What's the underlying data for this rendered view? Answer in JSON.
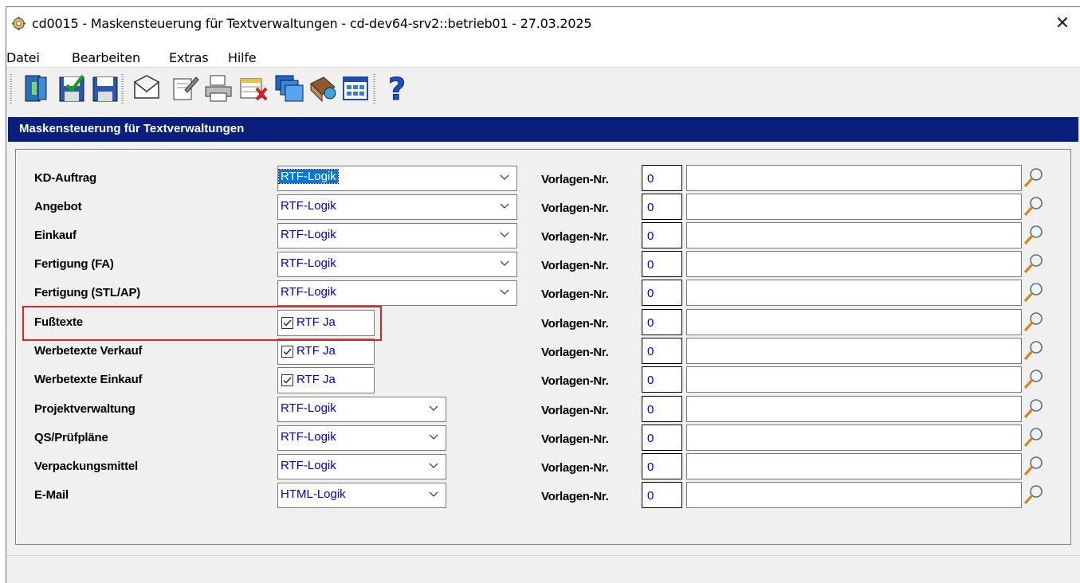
{
  "window": {
    "title": "cd0015 - Maskensteuerung für Textverwaltungen - cd-dev64-srv2::betrieb01 - 27.03.2025",
    "close_symbol": "✕"
  },
  "menu": [
    {
      "label": "Datei",
      "name": "menu-datei"
    },
    {
      "label": "Bearbeiten",
      "name": "menu-bearbeiten"
    },
    {
      "label": "Extras",
      "name": "menu-extras"
    },
    {
      "label": "Hilfe",
      "name": "menu-hilfe"
    }
  ],
  "toolbar": [
    {
      "icon": "exit-door-icon"
    },
    {
      "icon": "save-check-icon"
    },
    {
      "icon": "save-icon"
    },
    {
      "icon": "envelope-icon"
    },
    {
      "icon": "edit-document-icon"
    },
    {
      "icon": "printer-icon"
    },
    {
      "icon": "delete-record-icon"
    },
    {
      "icon": "windows-icon"
    },
    {
      "icon": "book-icon"
    },
    {
      "icon": "table-icon"
    },
    {
      "icon": "help-icon"
    }
  ],
  "panel": {
    "title": "Maskensteuerung für Textverwaltungen"
  },
  "rows": [
    {
      "label": "KD-Auftrag",
      "type": "combo",
      "value": "RTF-Logik",
      "selected": true,
      "wide": true,
      "vor_label": "Vorlagen-Nr.",
      "vor_value": "0",
      "vor_text": ""
    },
    {
      "label": "Angebot",
      "type": "combo",
      "value": "RTF-Logik",
      "selected": false,
      "wide": true,
      "vor_label": "Vorlagen-Nr.",
      "vor_value": "0",
      "vor_text": ""
    },
    {
      "label": "Einkauf",
      "type": "combo",
      "value": "RTF-Logik",
      "selected": false,
      "wide": true,
      "vor_label": "Vorlagen-Nr.",
      "vor_value": "0",
      "vor_text": ""
    },
    {
      "label": "Fertigung (FA)",
      "type": "combo",
      "value": "RTF-Logik",
      "selected": false,
      "wide": true,
      "vor_label": "Vorlagen-Nr.",
      "vor_value": "0",
      "vor_text": ""
    },
    {
      "label": "Fertigung (STL/AP)",
      "type": "combo",
      "value": "RTF-Logik",
      "selected": false,
      "wide": true,
      "vor_label": "Vorlagen-Nr.",
      "vor_value": "0",
      "vor_text": ""
    },
    {
      "label": "Fußtexte",
      "type": "check",
      "value": "RTF Ja",
      "checked": true,
      "vor_label": "Vorlagen-Nr.",
      "vor_value": "0",
      "vor_text": ""
    },
    {
      "label": "Werbetexte Verkauf",
      "type": "check",
      "value": "RTF Ja",
      "checked": true,
      "vor_label": "Vorlagen-Nr.",
      "vor_value": "0",
      "vor_text": ""
    },
    {
      "label": "Werbetexte Einkauf",
      "type": "check",
      "value": "RTF Ja",
      "checked": true,
      "vor_label": "Vorlagen-Nr.",
      "vor_value": "0",
      "vor_text": ""
    },
    {
      "label": "Projektverwaltung",
      "type": "combo",
      "value": "RTF-Logik",
      "selected": false,
      "wide": false,
      "vor_label": "Vorlagen-Nr.",
      "vor_value": "0",
      "vor_text": ""
    },
    {
      "label": "QS/Prüfpläne",
      "type": "combo",
      "value": "RTF-Logik",
      "selected": false,
      "wide": false,
      "vor_label": "Vorlagen-Nr.",
      "vor_value": "0",
      "vor_text": ""
    },
    {
      "label": "Verpackungsmittel",
      "type": "combo",
      "value": "RTF-Logik",
      "selected": false,
      "wide": false,
      "vor_label": "Vorlagen-Nr.",
      "vor_value": "0",
      "vor_text": ""
    },
    {
      "label": "E-Mail",
      "type": "combo",
      "value": "HTML-Logik",
      "selected": false,
      "wide": false,
      "vor_label": "Vorlagen-Nr.",
      "vor_value": "0",
      "vor_text": ""
    }
  ],
  "colors": {
    "panel_header": "#0a1f7c",
    "value_text": "#0000c0",
    "highlight": "#e02424"
  }
}
